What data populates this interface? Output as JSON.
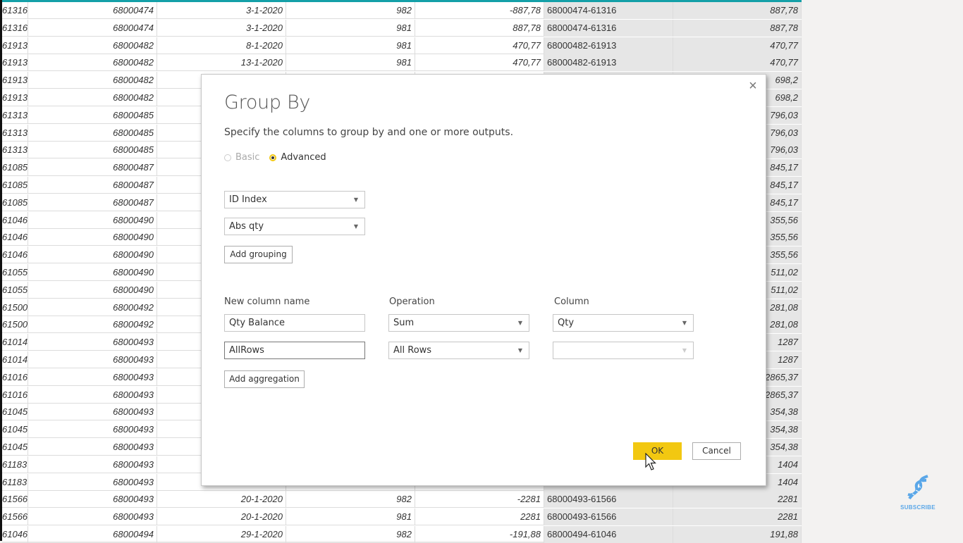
{
  "table": {
    "rows": [
      [
        "61316",
        "68000474",
        "3-1-2020",
        "982",
        "-887,78",
        "68000474-61316",
        "887,78"
      ],
      [
        "61316",
        "68000474",
        "3-1-2020",
        "981",
        "887,78",
        "68000474-61316",
        "887,78"
      ],
      [
        "61913",
        "68000482",
        "8-1-2020",
        "981",
        "470,77",
        "68000482-61913",
        "470,77"
      ],
      [
        "61913",
        "68000482",
        "13-1-2020",
        "981",
        "470,77",
        "68000482-61913",
        "470,77"
      ],
      [
        "61913",
        "68000482",
        "",
        "",
        "",
        "",
        "698,2"
      ],
      [
        "61913",
        "68000482",
        "",
        "",
        "",
        "",
        "698,2"
      ],
      [
        "61313",
        "68000485",
        "",
        "",
        "",
        "",
        "796,03"
      ],
      [
        "61313",
        "68000485",
        "",
        "",
        "",
        "",
        "796,03"
      ],
      [
        "61313",
        "68000485",
        "",
        "",
        "",
        "",
        "796,03"
      ],
      [
        "61085",
        "68000487",
        "",
        "",
        "",
        "",
        "845,17"
      ],
      [
        "61085",
        "68000487",
        "",
        "",
        "",
        "",
        "845,17"
      ],
      [
        "61085",
        "68000487",
        "",
        "",
        "",
        "",
        "845,17"
      ],
      [
        "61046",
        "68000490",
        "",
        "",
        "",
        "",
        "355,56"
      ],
      [
        "61046",
        "68000490",
        "",
        "",
        "",
        "",
        "355,56"
      ],
      [
        "61046",
        "68000490",
        "",
        "",
        "",
        "",
        "355,56"
      ],
      [
        "61055",
        "68000490",
        "",
        "",
        "",
        "",
        "511,02"
      ],
      [
        "61055",
        "68000490",
        "",
        "",
        "",
        "",
        "511,02"
      ],
      [
        "61500",
        "68000492",
        "",
        "",
        "",
        "",
        "281,08"
      ],
      [
        "61500",
        "68000492",
        "",
        "",
        "",
        "",
        "281,08"
      ],
      [
        "61014",
        "68000493",
        "",
        "",
        "",
        "",
        "1287"
      ],
      [
        "61014",
        "68000493",
        "",
        "",
        "",
        "",
        "1287"
      ],
      [
        "61016",
        "68000493",
        "",
        "",
        "",
        "",
        "2865,37"
      ],
      [
        "61016",
        "68000493",
        "",
        "",
        "",
        "",
        "2865,37"
      ],
      [
        "61045",
        "68000493",
        "",
        "",
        "",
        "",
        "354,38"
      ],
      [
        "61045",
        "68000493",
        "",
        "",
        "",
        "",
        "354,38"
      ],
      [
        "61045",
        "68000493",
        "",
        "",
        "",
        "",
        "354,38"
      ],
      [
        "61183",
        "68000493",
        "",
        "",
        "",
        "",
        "1404"
      ],
      [
        "61183",
        "68000493",
        "",
        "",
        "",
        "",
        "1404"
      ],
      [
        "61566",
        "68000493",
        "20-1-2020",
        "982",
        "-2281",
        "68000493-61566",
        "2281"
      ],
      [
        "61566",
        "68000493",
        "20-1-2020",
        "981",
        "2281",
        "68000493-61566",
        "2281"
      ],
      [
        "61046",
        "68000494",
        "29-1-2020",
        "982",
        "-191,88",
        "68000494-61046",
        "191,88"
      ]
    ]
  },
  "dialog": {
    "title": "Group By",
    "description": "Specify the columns to group by and one or more outputs.",
    "mode_options": [
      {
        "label": "Basic",
        "selected": false,
        "enabled": false
      },
      {
        "label": "Advanced",
        "selected": true,
        "enabled": true
      }
    ],
    "grouping_columns": [
      "ID Index",
      "Abs qty"
    ],
    "add_grouping_label": "Add grouping",
    "headers": {
      "new_column_name": "New column name",
      "operation": "Operation",
      "column": "Column"
    },
    "aggregations": [
      {
        "name": "Qty Balance",
        "operation": "Sum",
        "column": "Qty"
      },
      {
        "name": "AllRows",
        "operation": "All Rows",
        "column": ""
      }
    ],
    "add_aggregation_label": "Add aggregation",
    "ok_label": "OK",
    "cancel_label": "Cancel",
    "close_icon": "×"
  },
  "overlay": {
    "subscribe_label": "SUBSCRIBE"
  },
  "colors": {
    "accent_yellow": "#f2c811",
    "header_teal": "#14a0a8",
    "subscribe_blue": "#5aa7e8"
  }
}
